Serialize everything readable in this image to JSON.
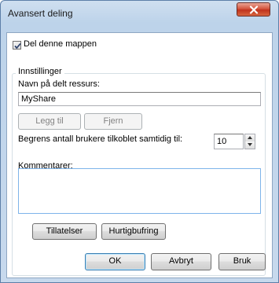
{
  "window": {
    "title": "Avansert deling"
  },
  "share": {
    "checkbox_label": "Del denne mappen",
    "checked": true
  },
  "settings": {
    "group_label": "Innstillinger",
    "share_name_label": "Navn på delt ressurs:",
    "share_name_value": "MyShare",
    "add_button": "Legg til",
    "remove_button": "Fjern",
    "limit_label": "Begrens antall brukere tilkoblet samtidig til:",
    "limit_value": "10",
    "comments_label": "Kommentarer:",
    "comments_value": "",
    "permissions_button": "Tillatelser",
    "caching_button": "Hurtigbufring"
  },
  "footer": {
    "ok_button": "OK",
    "cancel_button": "Avbryt",
    "apply_button": "Bruk"
  },
  "icons": {
    "close": "close-icon",
    "check": "checkmark-icon",
    "spin_up": "arrow-up-icon",
    "spin_down": "arrow-down-icon"
  }
}
